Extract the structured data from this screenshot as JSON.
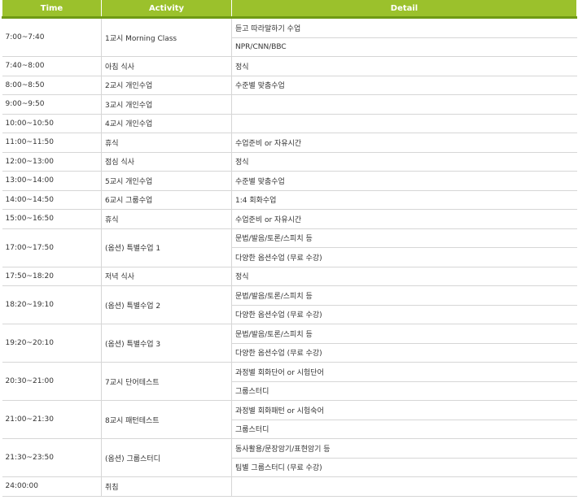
{
  "header": {
    "time": "Time",
    "activity": "Activity",
    "detail": "Detail"
  },
  "rows": [
    {
      "time": "7:00~7:40",
      "activity": "1교시 Morning Class",
      "details": [
        "듣고 따라말하기 수업",
        "NPR/CNN/BBC"
      ]
    },
    {
      "time": "7:40~8:00",
      "activity": "아침 식사",
      "details": [
        "정식"
      ]
    },
    {
      "time": "8:00~8:50",
      "activity": "2교시 개인수업",
      "details": [
        "수준별 맞춤수업"
      ]
    },
    {
      "time": "9:00~9:50",
      "activity": "3교시 개인수업",
      "details": [
        ""
      ]
    },
    {
      "time": "10:00~10:50",
      "activity": "4교시 개인수업",
      "details": [
        ""
      ]
    },
    {
      "time": "11:00~11:50",
      "activity": "휴식",
      "details": [
        "수업준비 or 자유시간"
      ]
    },
    {
      "time": "12:00~13:00",
      "activity": "점심 식사",
      "details": [
        "정식"
      ]
    },
    {
      "time": "13:00~14:00",
      "activity": "5교시 개인수업",
      "details": [
        "수준별 맞춤수업"
      ]
    },
    {
      "time": "14:00~14:50",
      "activity": "6교시 그룹수업",
      "details": [
        "1:4 회화수업"
      ]
    },
    {
      "time": "15:00~16:50",
      "activity": "휴식",
      "details": [
        "수업준비 or 자유시간"
      ]
    },
    {
      "time": "17:00~17:50",
      "activity": "(옵션) 특별수업 1",
      "details": [
        "문법/발음/토론/스피치 등",
        "다양한 옵션수업 (무료 수강)"
      ]
    },
    {
      "time": "17:50~18:20",
      "activity": "저녁 식사",
      "details": [
        "정식"
      ]
    },
    {
      "time": "18:20~19:10",
      "activity": "(옵션) 특별수업 2",
      "details": [
        "문법/발음/토론/스피치 등",
        "다양한 옵션수업 (무료 수강)"
      ]
    },
    {
      "time": "19:20~20:10",
      "activity": "(옵션) 특별수업 3",
      "details": [
        "문법/발음/토론/스피치 등",
        "다양한 옵션수업 (무료 수강)"
      ]
    },
    {
      "time": "20:30~21:00",
      "activity": "7교시 단어테스트",
      "details": [
        "과정별 회화단어 or 시험단어",
        "그룹스터디"
      ]
    },
    {
      "time": "21:00~21:30",
      "activity": "8교시 패턴테스트",
      "details": [
        "과정별 회화패턴 or 시험숙어",
        "그룹스터디"
      ]
    },
    {
      "time": "21:30~23:50",
      "activity": "(옵션) 그룹스터디",
      "details": [
        "동사활용/문장암기/표현암기 등",
        "팀별 그룹스터디 (무료 수강)"
      ]
    },
    {
      "time": "24:00:00",
      "activity": "취침",
      "details": [
        ""
      ]
    }
  ]
}
